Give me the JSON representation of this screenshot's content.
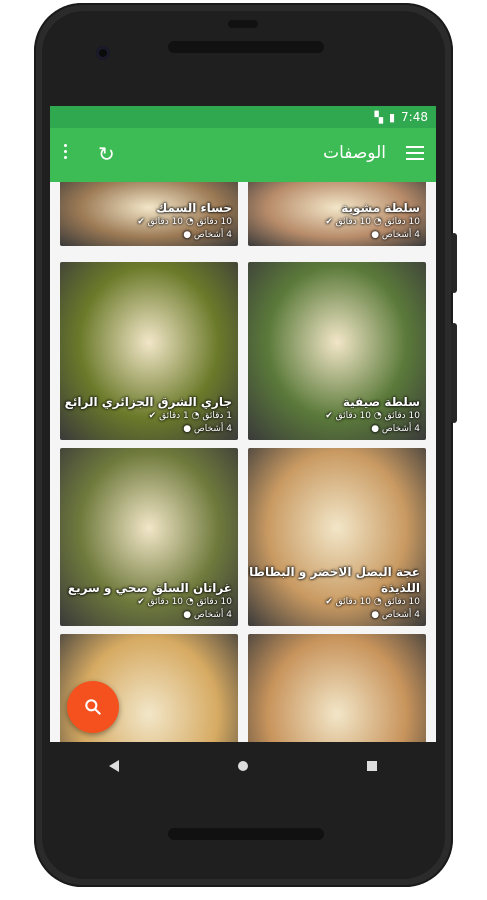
{
  "status": {
    "time": "7:48"
  },
  "appbar": {
    "title": "الوصفات",
    "refresh_icon": "refresh-icon",
    "menu_icon": "menu-icon",
    "more_icon": "more-vert-icon"
  },
  "recipes": [
    {
      "name": "سلطة مشوية",
      "time": "10 دقائق",
      "cook": "10 دقائق",
      "people": "4 أشخاص",
      "color": "#b88c6a"
    },
    {
      "name": "حساء السمك",
      "time": "10 دقائق",
      "cook": "10 دقائق",
      "people": "4 أشخاص",
      "color": "#9c7a55"
    },
    {
      "name": "سلطة صيفية",
      "time": "10 دقائق",
      "cook": "10 دقائق",
      "people": "4 أشخاص",
      "color": "#5b7a3a"
    },
    {
      "name": "جاري الشرق الجزائري الرائع",
      "time": "1 دقائق",
      "cook": "1 دقائق",
      "people": "4 أشخاص",
      "color": "#6b7a2a"
    },
    {
      "name": "عجة البصل الاخضر و البطاطا اللذيذة",
      "time": "10 دقائق",
      "cook": "10 دقائق",
      "people": "4 أشخاص",
      "color": "#c99a62"
    },
    {
      "name": "غراتان السلق صحي و سريع",
      "time": "10 دقائق",
      "cook": "10 دقائق",
      "people": "4 أشخاص",
      "color": "#6f7a3c"
    },
    {
      "name": "",
      "time": "",
      "cook": "",
      "people": "",
      "color": "#c8945c"
    },
    {
      "name": "",
      "time": "",
      "cook": "",
      "people": "",
      "color": "#d6aa62"
    }
  ],
  "fab": {
    "icon": "search-icon"
  }
}
